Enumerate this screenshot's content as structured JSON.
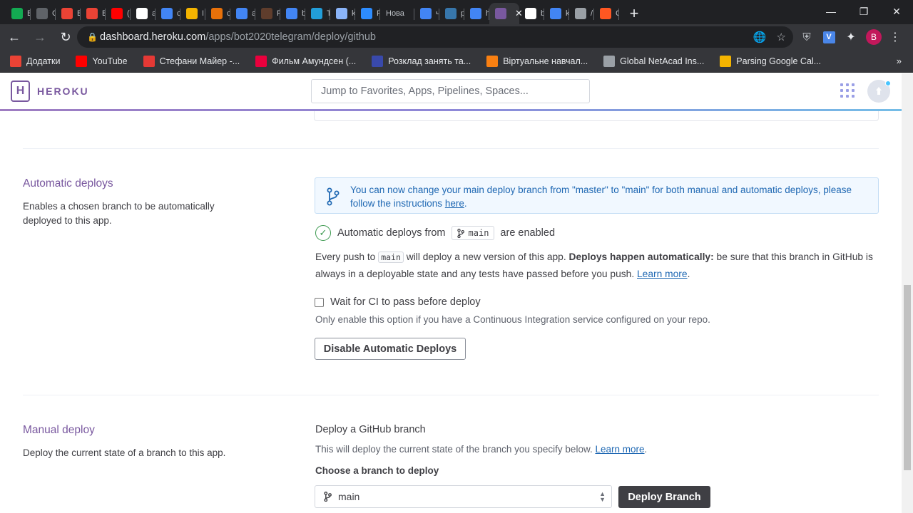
{
  "browser": {
    "tabs": [
      {
        "label": "E",
        "icon": "mongodb-icon",
        "color": "#13aa52",
        "active": false
      },
      {
        "label": "C",
        "icon": "grid-icon",
        "color": "#5f6368",
        "active": false
      },
      {
        "label": "E",
        "icon": "gmail-icon",
        "color": "#ea4335",
        "active": false
      },
      {
        "label": "E",
        "icon": "gmail-icon",
        "color": "#ea4335",
        "active": false
      },
      {
        "label": "(",
        "icon": "youtube-icon",
        "color": "#ff0000",
        "active": false
      },
      {
        "label": "a",
        "icon": "github-icon",
        "color": "#ffffff",
        "active": false
      },
      {
        "label": "c",
        "icon": "google-icon",
        "color": "#4285f4",
        "active": false
      },
      {
        "label": "I",
        "icon": "book-icon",
        "color": "#f4b400",
        "active": false
      },
      {
        "label": "c",
        "icon": "book-icon",
        "color": "#e8710a",
        "active": false
      },
      {
        "label": "a",
        "icon": "google-icon",
        "color": "#4285f4",
        "active": false
      },
      {
        "label": "F",
        "icon": "sa-icon",
        "color": "#5f3d2c",
        "active": false
      },
      {
        "label": "b",
        "icon": "google-icon",
        "color": "#4285f4",
        "active": false
      },
      {
        "label": "T",
        "icon": "telegram-icon",
        "color": "#229ed9",
        "active": false
      },
      {
        "label": "k",
        "icon": "puzzle-icon",
        "color": "#8ab4f8",
        "active": false
      },
      {
        "label": "F",
        "icon": "zoom-icon",
        "color": "#2d8cff",
        "active": false
      },
      {
        "label": "Нова",
        "icon": "",
        "color": "",
        "active": false
      },
      {
        "label": "ч",
        "icon": "google-icon",
        "color": "#4285f4",
        "active": false
      },
      {
        "label": "p",
        "icon": "python-icon",
        "color": "#3776ab",
        "active": false
      },
      {
        "label": "h",
        "icon": "google-icon",
        "color": "#4285f4",
        "active": false
      },
      {
        "label": "b",
        "icon": "heroku-icon",
        "color": "#79589f",
        "active": true
      },
      {
        "label": "b",
        "icon": "github-icon",
        "color": "#ffffff",
        "active": false
      },
      {
        "label": "k",
        "icon": "google-icon",
        "color": "#4285f4",
        "active": false
      },
      {
        "label": "/",
        "icon": "globe-icon",
        "color": "#9aa0a6",
        "active": false
      },
      {
        "label": "C",
        "icon": "blogger-icon",
        "color": "#ff5722",
        "active": false
      }
    ],
    "url_host": "dashboard.heroku.com",
    "url_path": "/apps/bot2020telegram/deploy/github",
    "profile_initial": "B",
    "ext_initial": "V",
    "bookmarks": [
      {
        "label": "Додатки",
        "icon": "apps-grid-icon",
        "color": "#ea4335"
      },
      {
        "label": "YouTube",
        "icon": "youtube-icon",
        "color": "#ff0000"
      },
      {
        "label": "Стефани Майер -...",
        "icon": "star-icon",
        "color": "#e53935"
      },
      {
        "label": "Фильм Амундсен (...",
        "icon": "ivi-icon",
        "color": "#ea003d"
      },
      {
        "label": "Розклад занять та...",
        "icon": "university-icon",
        "color": "#3949ab"
      },
      {
        "label": "Віртуальне навчал...",
        "icon": "moodle-icon",
        "color": "#f98012"
      },
      {
        "label": "Global NetAcad Ins...",
        "icon": "cisco-icon",
        "color": "#9aa0a6"
      },
      {
        "label": "Parsing Google Cal...",
        "icon": "lamp-icon",
        "color": "#f4b400"
      }
    ],
    "bookmarks_more": "»"
  },
  "heroku": {
    "logo_letter": "H",
    "brand": "HEROKU",
    "search_placeholder": "Jump to Favorites, Apps, Pipelines, Spaces..."
  },
  "automatic": {
    "title": "Automatic deploys",
    "description": "Enables a chosen branch to be automatically deployed to this app.",
    "notice_text": "You can now change your main deploy branch from \"master\" to \"main\" for both manual and automatic deploys, please follow the instructions ",
    "notice_link": "here",
    "notice_end": ".",
    "enabled_prefix": "Automatic deploys from",
    "branch": "main",
    "enabled_suffix": "are enabled",
    "push_prefix": "Every push to",
    "push_branch": "main",
    "push_mid": " will deploy a new version of this app. ",
    "push_bold": "Deploys happen automatically:",
    "push_rest": " be sure that this branch in GitHub is always in a deployable state and any tests have passed before you push. ",
    "learn_more": "Learn more",
    "push_end": ".",
    "ci_label": "Wait for CI to pass before deploy",
    "ci_checked": false,
    "ci_help": "Only enable this option if you have a Continuous Integration service configured on your repo.",
    "disable_button": "Disable Automatic Deploys"
  },
  "manual": {
    "title": "Manual deploy",
    "description": "Deploy the current state of a branch to this app.",
    "subtitle": "Deploy a GitHub branch",
    "sub_desc": "This will deploy the current state of the branch you specify below. ",
    "learn_more": "Learn more",
    "sub_end": ".",
    "choose_label": "Choose a branch to deploy",
    "selected_branch": "main",
    "deploy_button": "Deploy Branch"
  },
  "colors": {
    "accent": "#79589f",
    "link": "#1f68b3",
    "success": "#3d9a50",
    "dark_button": "#3f3f44"
  }
}
